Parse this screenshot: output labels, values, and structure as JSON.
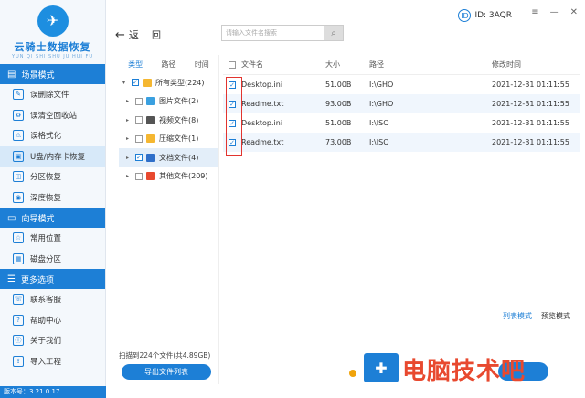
{
  "app": {
    "logo_text": "云骑士数据恢复",
    "logo_sub": "YUN QI SHI SHU JU HUI FU",
    "version": "版本号：3.21.0.17"
  },
  "sidebar": {
    "sections": [
      {
        "title": "场景模式",
        "items": [
          {
            "label": "误删除文件"
          },
          {
            "label": "误清空回收站"
          },
          {
            "label": "误格式化"
          },
          {
            "label": "U盘/内存卡恢复",
            "active": true
          },
          {
            "label": "分区恢复"
          },
          {
            "label": "深度恢复"
          }
        ]
      },
      {
        "title": "向导模式",
        "items": [
          {
            "label": "常用位置"
          },
          {
            "label": "磁盘分区"
          }
        ]
      },
      {
        "title": "更多选项",
        "items": [
          {
            "label": "联系客服"
          },
          {
            "label": "帮助中心"
          },
          {
            "label": "关于我们"
          },
          {
            "label": "导入工程"
          }
        ]
      }
    ]
  },
  "topbar": {
    "back_label": "返",
    "back2_label": "回",
    "search_placeholder": "请输入文件名搜索",
    "user_id": "ID: 3AQR"
  },
  "tree": {
    "tabs": [
      "类型",
      "路径",
      "时间"
    ],
    "rows": [
      {
        "label": "所有类型(224)",
        "checked": true,
        "indent": false,
        "icon_color": "#f5b731"
      },
      {
        "label": "图片文件(2)",
        "checked": false,
        "indent": true,
        "icon_color": "#3aa0e0"
      },
      {
        "label": "视频文件(8)",
        "checked": false,
        "indent": true,
        "icon_color": "#555555"
      },
      {
        "label": "压缩文件(1)",
        "checked": false,
        "indent": true,
        "icon_color": "#f5b731"
      },
      {
        "label": "文档文件(4)",
        "checked": true,
        "indent": true,
        "icon_color": "#2f6fc9",
        "selected": true
      },
      {
        "label": "其他文件(209)",
        "checked": false,
        "indent": true,
        "icon_color": "#e8492f"
      }
    ],
    "scan_info": "扫描到224个文件(共4.89GB)",
    "export_label": "导出文件列表"
  },
  "table": {
    "headers": {
      "name": "文件名",
      "size": "大小",
      "path": "路径",
      "time": "修改时间"
    },
    "rows": [
      {
        "name": "Desktop.ini",
        "size": "51.00B",
        "path": "I:\\GHO",
        "time": "2021-12-31 01:11:55"
      },
      {
        "name": "Readme.txt",
        "size": "93.00B",
        "path": "I:\\GHO",
        "time": "2021-12-31 01:11:55"
      },
      {
        "name": "Desktop.ini",
        "size": "51.00B",
        "path": "I:\\ISO",
        "time": "2021-12-31 01:11:55"
      },
      {
        "name": "Readme.txt",
        "size": "73.00B",
        "path": "I:\\ISO",
        "time": "2021-12-31 01:11:55"
      }
    ]
  },
  "view_modes": {
    "list": "列表模式",
    "preview": "预览模式"
  },
  "watermark": "电脑技术吧",
  "colors": {
    "accent": "#1d7fd6",
    "highlight": "#e2342f",
    "watermark": "#e8492f"
  }
}
